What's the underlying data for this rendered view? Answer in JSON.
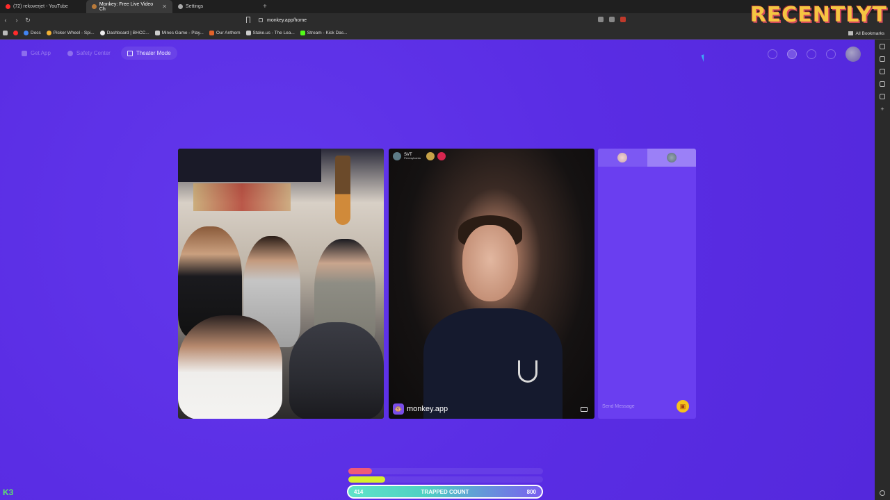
{
  "browser": {
    "tabs": [
      {
        "label": "(72) rekoverjet - YouTube",
        "active": false,
        "color": "#ff2b2b"
      },
      {
        "label": "Monkey: Free Live Video Ch",
        "active": true,
        "color": "#b97a3a"
      },
      {
        "label": "Settings",
        "active": false,
        "color": "#aaaaaa"
      }
    ],
    "url": "monkey.app/home",
    "bookmarks": [
      {
        "label": "Docs",
        "color": "#4285f4"
      },
      {
        "label": "Picker Wheel - Spi...",
        "color": "#f2b134"
      },
      {
        "label": "Dashboard | BHCC...",
        "color": "#eeeeee"
      },
      {
        "label": "Mines Game - Play...",
        "color": "#cccccc"
      },
      {
        "label": "Our Anthem",
        "color": "#e2632b"
      },
      {
        "label": "Stake.us - The Lea...",
        "color": "#cccccc"
      },
      {
        "label": "Stream - Kick Das...",
        "color": "#53fc18"
      }
    ],
    "all_bookmarks": "All Bookmarks"
  },
  "watermark": "RECENTLYT",
  "topnav": {
    "get_app": "Get App",
    "safety_center": "Safety Center",
    "theater_mode": "Theater Mode"
  },
  "remote_user": {
    "name": "SVT",
    "location": "Pennsylvania"
  },
  "brand": {
    "text": "monkey.app"
  },
  "chat": {
    "placeholder": "Send Message"
  },
  "trapped": {
    "left_value": "414",
    "label": "TRAPPED COUNT",
    "right_value": "800",
    "red_progress": 0.12,
    "yellow_progress": 0.19
  },
  "bottom_left": "K3"
}
